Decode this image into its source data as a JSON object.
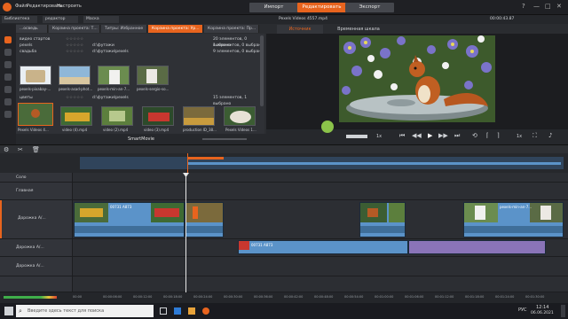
{
  "menu": {
    "file": "Файл",
    "edit": "Редактировать",
    "settings": "Настроить"
  },
  "modes": {
    "import": "Импорт",
    "edit": "Редактировать",
    "export": "Экспорт"
  },
  "window_controls": {
    "help": "?",
    "minimize": "—",
    "maximize": "□",
    "close": "✕"
  },
  "library_tabs": {
    "library": "Библиотека",
    "editor": "редактор",
    "mask": "Маска"
  },
  "category_tabs": [
    "Корзина проекта: Т...",
    "Титры: Избранное",
    "Корзина проекта: Ур...",
    "Корзина проекта: Пр..."
  ],
  "category_tab_lead": "...осведь",
  "library_rows": [
    {
      "name": "видео стартов",
      "rating": "☆☆☆☆☆",
      "path": "",
      "count": "20 элементов, 0 выбрано"
    },
    {
      "name": "pexels",
      "rating": "☆☆☆☆☆",
      "path": "d:\\футажи",
      "count": "1 элементов, 0 выбрано"
    },
    {
      "name": "свадьба",
      "rating": "☆☆☆☆☆",
      "path": "d:\\футажи\\pexels",
      "count": "9 элементов, 0 выбрано"
    },
    {
      "name": "цветы",
      "rating": "☆☆☆☆☆",
      "path": "d:\\футажи\\pexels",
      "count": "15 элементов, 1 выбрано"
    }
  ],
  "thumbnails_row1": [
    "pexels-pixabay-...",
    "pexels-asad-phot...",
    "pexels-min-an-7...",
    "pexels-sergio-so..."
  ],
  "thumbnails_row2": [
    "Pexels Videos 4...",
    "video (4).mp4",
    "video (2).mp4",
    "video (3).mp4",
    "production ID_38...",
    "Pexels Videos 1..."
  ],
  "library_bottom_label": "SmartMovie",
  "player": {
    "file_title": "Pexels Videos 4557.mp4",
    "tab_source": "Источник",
    "tab_timeline": "Временная шкала",
    "timecode": "00:00:43.87",
    "speed": "1x",
    "zoom_label": "1x"
  },
  "tracks": [
    {
      "name": "Соло"
    },
    {
      "name": "Главная"
    },
    {
      "name": "Дорожка А/..."
    },
    {
      "name": "Дорожка А/..."
    },
    {
      "name": "Дорожка А/..."
    }
  ],
  "clips": {
    "clip1_label": "00731 A873",
    "clip2_label": "00731 A873",
    "clip3_label": "pexels-min-an-7..."
  },
  "ruler_ticks": [
    "00:00",
    "00:00:06:00",
    "00:00:12:00",
    "00:00:18:00",
    "00:00:24:00",
    "00:00:30:00",
    "00:00:36:00",
    "00:00:42:00",
    "00:00:48:00",
    "00:00:54:00",
    "00:01:00:00",
    "00:01:06:00",
    "00:01:12:00",
    "00:01:18:00",
    "00:01:24:00",
    "00:01:30:00"
  ],
  "taskbar": {
    "search_placeholder": "Введите здесь текст для поиска",
    "time": "12:14",
    "date": "06.06.2021",
    "lang": "РУС"
  },
  "colors": {
    "accent": "#e8641e",
    "clip_blue": "#5b93c9",
    "clip_purple": "#8a74b8"
  }
}
